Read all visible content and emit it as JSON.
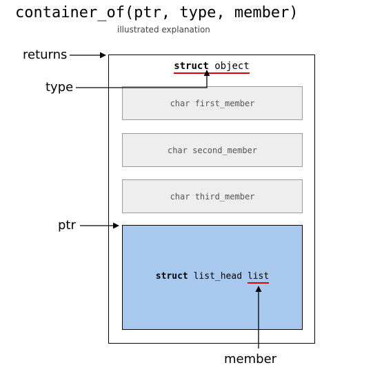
{
  "title": "container_of(ptr, type, member)",
  "subtitle": "illustrated explanation",
  "labels": {
    "returns": "returns",
    "type": "type",
    "ptr": "ptr",
    "member": "member"
  },
  "struct": {
    "keyword": "struct",
    "name": "object",
    "members": {
      "m1": "char first_member",
      "m2": "char second_member",
      "m3": "char third_member"
    },
    "list": {
      "keyword": "struct",
      "type": "list_head",
      "name": "list"
    }
  }
}
